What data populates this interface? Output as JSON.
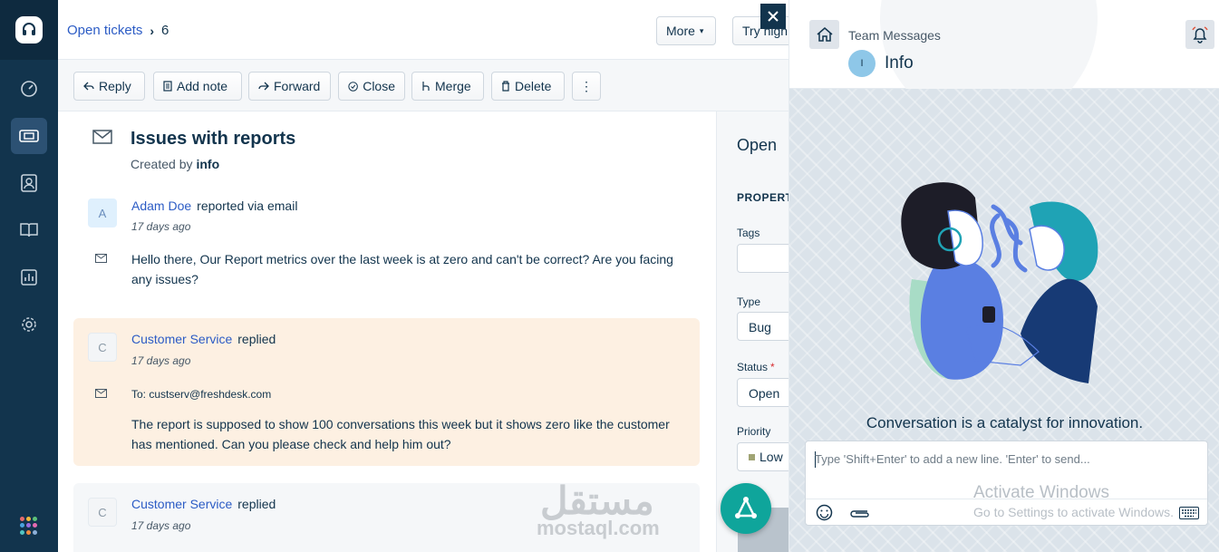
{
  "header": {
    "breadcrumb_link": "Open tickets",
    "breadcrumb_number": "6",
    "more_label": "More",
    "try_label": "Try high"
  },
  "toolbar": {
    "reply": "Reply",
    "add_note": "Add note",
    "forward": "Forward",
    "close": "Close",
    "merge": "Merge",
    "delete": "Delete"
  },
  "ticket": {
    "subject": "Issues with reports",
    "created_by_label": "Created by",
    "created_by": "info"
  },
  "messages": [
    {
      "avatar": "A",
      "author": "Adam Doe",
      "action": "reported via email",
      "when": "17 days ago",
      "body": "Hello there, Our Report metrics over the last week is at zero and can't be correct? Are you facing any issues?"
    },
    {
      "avatar": "C",
      "author": "Customer Service",
      "action": "replied",
      "when": "17 days ago",
      "to": "To: custserv@freshdesk.com",
      "body": "The report is supposed to show 100 conversations this week but it shows zero like the customer has mentioned. Can you please check and help him out?"
    },
    {
      "avatar": "C",
      "author": "Customer Service",
      "action": "replied",
      "when": "17 days ago"
    }
  ],
  "properties": {
    "status_heading": "Open",
    "section": "PROPERTI",
    "tags_label": "Tags",
    "type_label": "Type",
    "type_value": "Bug",
    "status_label": "Status",
    "required_mark": "*",
    "status_value": "Open",
    "priority_label": "Priority",
    "priority_value": "Low",
    "priority_color": "#a0a474"
  },
  "team_panel": {
    "title": "Team Messages",
    "channel_avatar": "I",
    "channel_name": "Info",
    "tagline": "Conversation is a catalyst for innovation.",
    "composer_placeholder": "Type 'Shift+Enter' to add a new line. 'Enter' to send...",
    "watermark_title": "Activate Windows",
    "watermark_sub": "Go to Settings to activate Windows."
  },
  "overlay": {
    "watermark_ar": "مستقل",
    "watermark_en": "mostaql.com"
  },
  "colors": {
    "nav_bg": "#12344d",
    "accent": "#2c5cc5",
    "fab": "#0fa59b",
    "reply_card_bg": "#fdf0e2",
    "note_card_bg": "#f5f7f9"
  },
  "icons": [
    "headset-icon",
    "dashboard-icon",
    "ticket-icon",
    "contacts-icon",
    "book-icon",
    "reports-icon",
    "gear-icon",
    "apps-grid-icon",
    "envelope-icon",
    "home-icon",
    "bell-icon",
    "emoji-icon",
    "paperclip-icon",
    "keyboard-icon",
    "close-icon",
    "bot-icon"
  ]
}
